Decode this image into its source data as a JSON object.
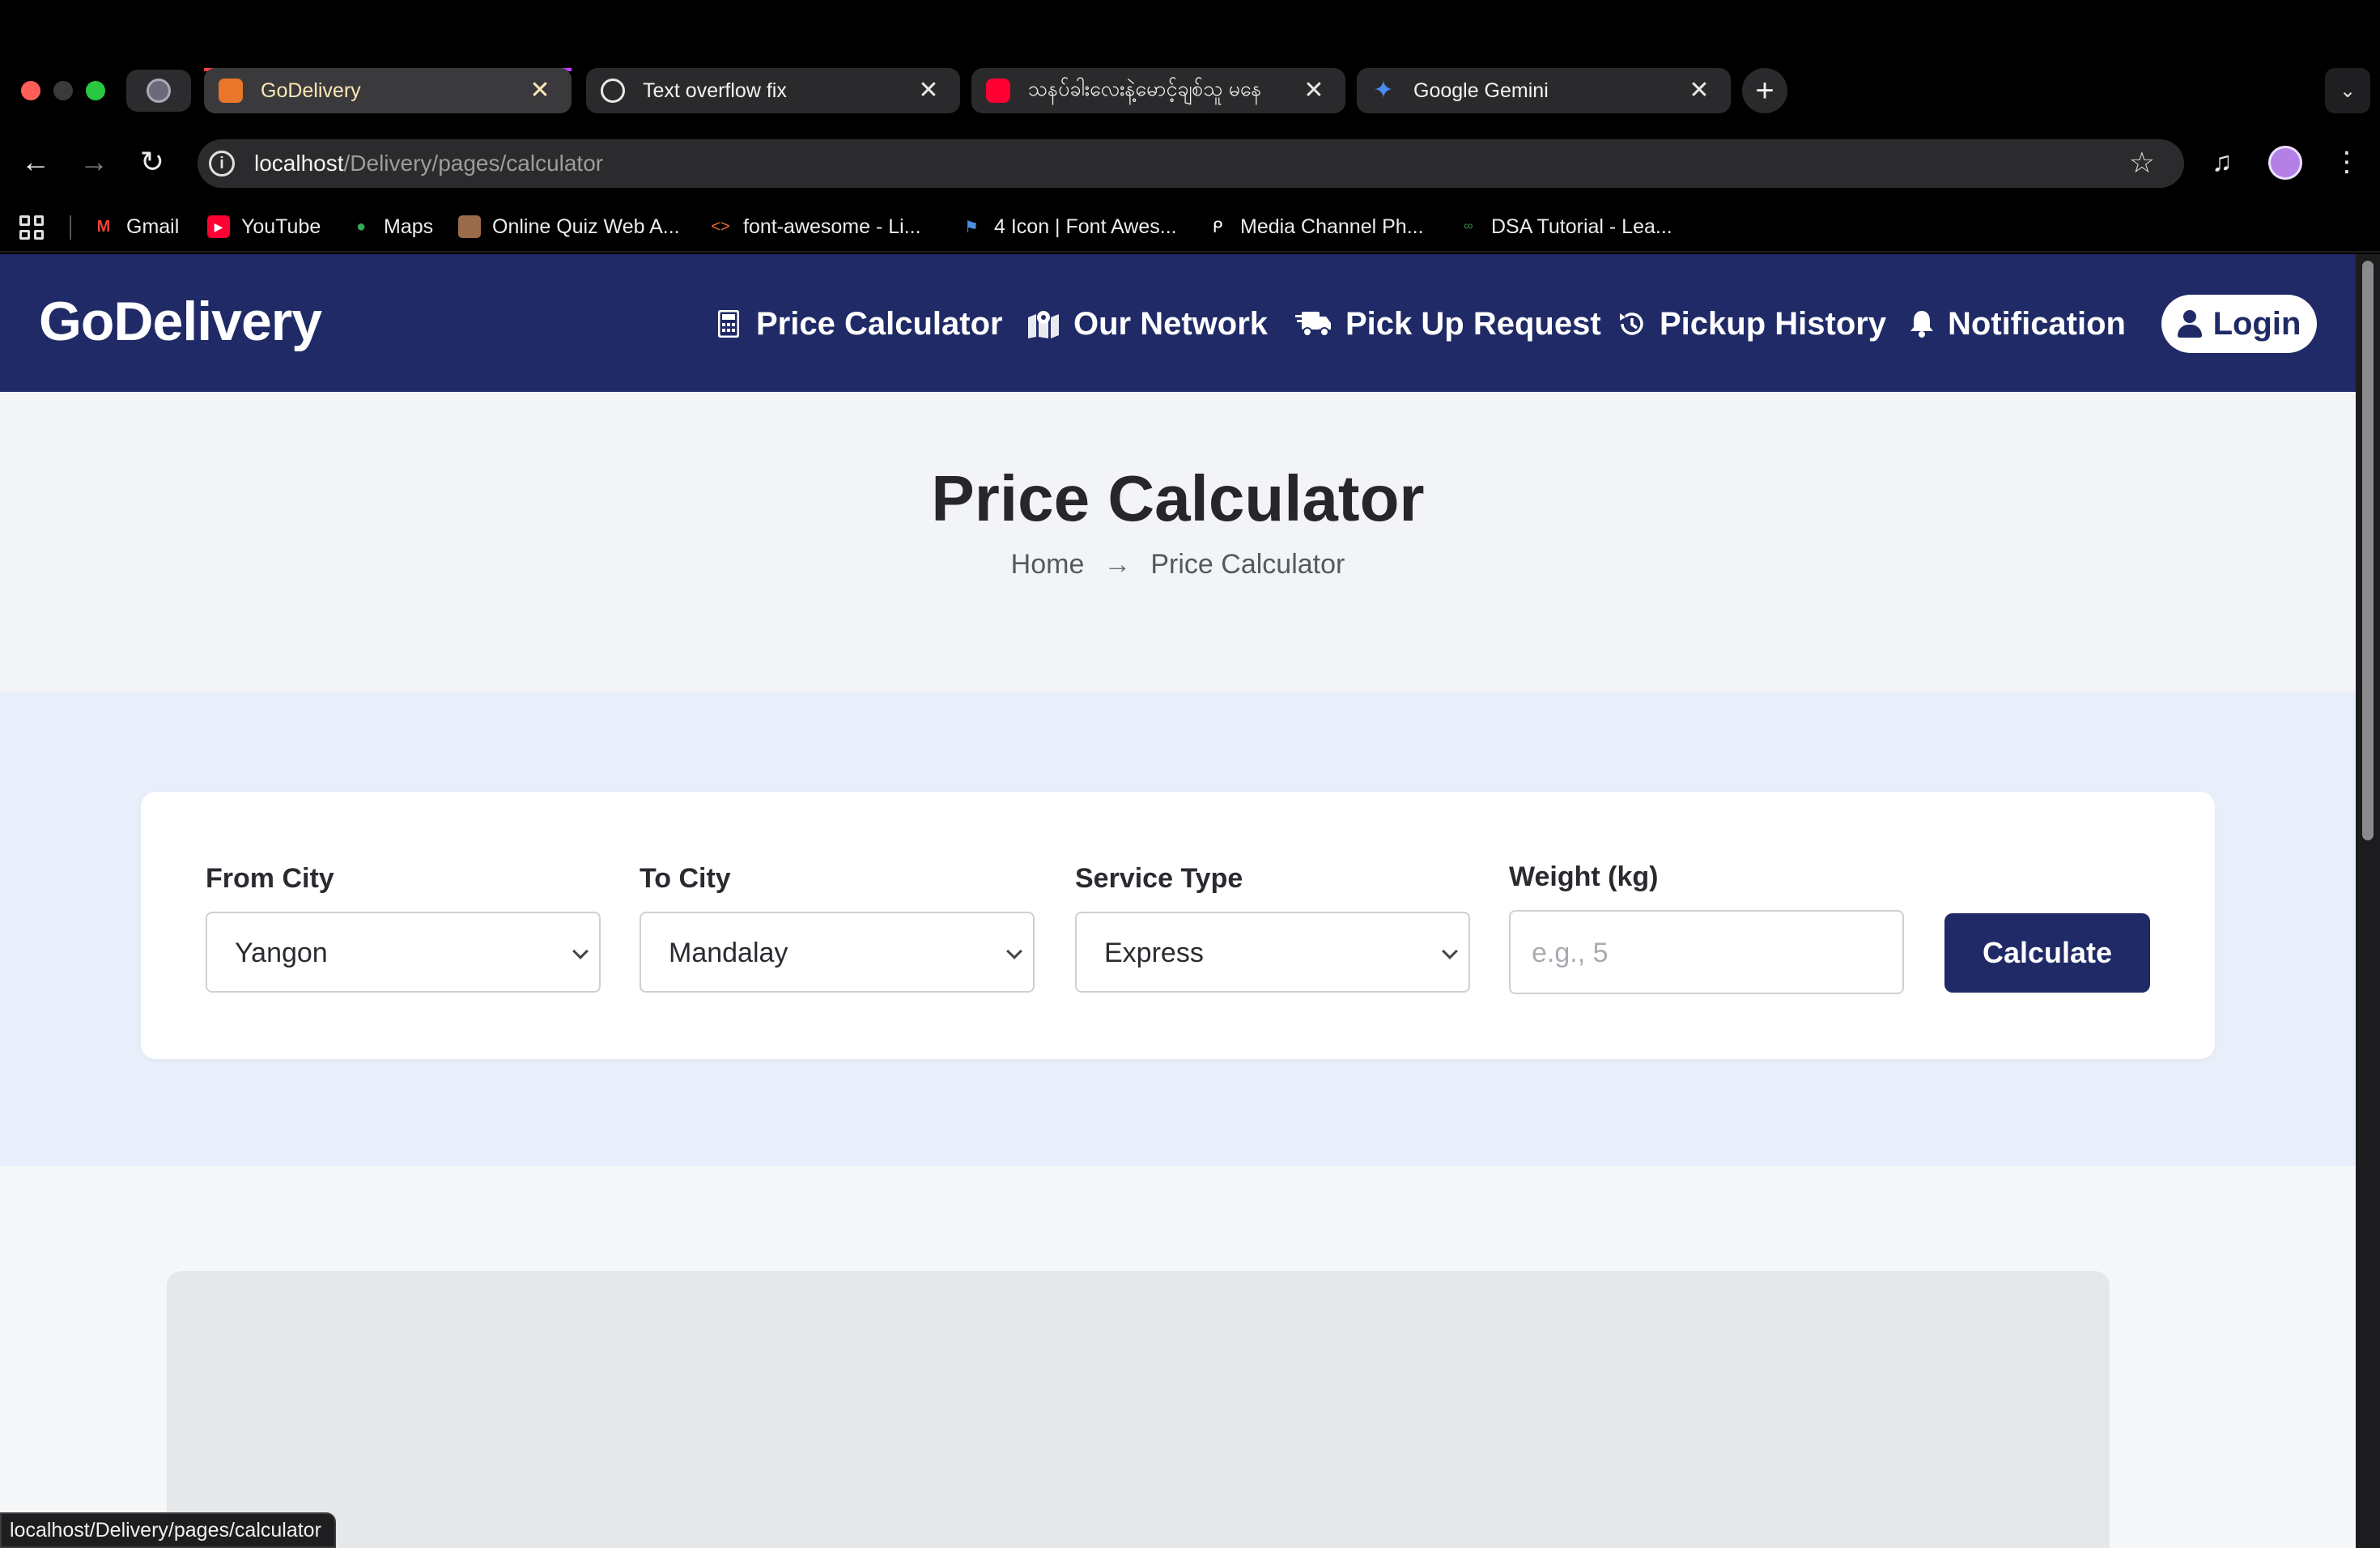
{
  "browser": {
    "tabs": [
      {
        "title": "GoDelivery",
        "active": true,
        "favicon_color": "#e9762b"
      },
      {
        "title": "Text overflow fix",
        "active": false,
        "favicon_color": "#ffffff"
      },
      {
        "title": "သနပ်ခါးလေးနဲ့မောင့်ချစ်သူ မနေ",
        "active": false,
        "favicon_color": "#ff0033"
      },
      {
        "title": "Google Gemini",
        "active": false,
        "favicon_color": "#4b8df8"
      }
    ],
    "new_tab_icon": "+",
    "url_host": "localhost",
    "url_path": "/Delivery/pages/calculator",
    "bookmarks": [
      {
        "label": "Gmail",
        "icon": "gmail-icon",
        "color": "#ea4335"
      },
      {
        "label": "YouTube",
        "icon": "youtube-icon",
        "color": "#ff0033"
      },
      {
        "label": "Maps",
        "icon": "maps-icon",
        "color": "#34a853"
      },
      {
        "label": "Online Quiz Web A...",
        "icon": "quiz-icon",
        "color": "#9a6b4a"
      },
      {
        "label": "font-awesome - Li...",
        "icon": "code-icon",
        "color": "#f26b3a"
      },
      {
        "label": "4 Icon | Font Awes...",
        "icon": "flag-icon",
        "color": "#4a90e2"
      },
      {
        "label": "Media Channel Ph...",
        "icon": "media-icon",
        "color": "#ffffff"
      },
      {
        "label": "DSA Tutorial - Lea...",
        "icon": "gfg-icon",
        "color": "#2f8d46"
      }
    ],
    "status_url": "localhost/Delivery/pages/calculator"
  },
  "site": {
    "brand": "GoDelivery",
    "nav": [
      {
        "label": "Price Calculator",
        "icon": "calculator-icon"
      },
      {
        "label": "Our Network",
        "icon": "map-location-icon"
      },
      {
        "label": "Pick Up Request",
        "icon": "truck-fast-icon"
      },
      {
        "label": "Pickup History",
        "icon": "history-icon"
      },
      {
        "label": "Notification",
        "icon": "bell-icon"
      }
    ],
    "login_label": "Login",
    "colors": {
      "primary": "#1f2a66",
      "hero_bg": "#f3f4f6",
      "band_bg": "#e8effb"
    }
  },
  "hero": {
    "title": "Price Calculator",
    "breadcrumb": {
      "home": "Home",
      "separator": "→",
      "current": "Price Calculator"
    }
  },
  "form": {
    "from_city": {
      "label": "From City",
      "value": "Yangon"
    },
    "to_city": {
      "label": "To City",
      "value": "Mandalay"
    },
    "service_type": {
      "label": "Service Type",
      "value": "Express"
    },
    "weight": {
      "label": "Weight (kg)",
      "placeholder": "e.g., 5",
      "value": ""
    },
    "submit_label": "Calculate"
  }
}
